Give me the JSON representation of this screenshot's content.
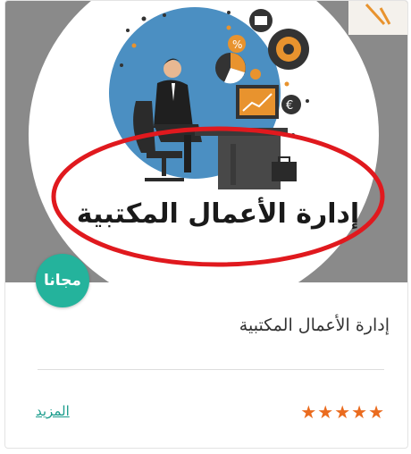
{
  "course": {
    "cover_text": "إدارة الأعمال المكتبية",
    "badge": "مجانا",
    "title": "إدارة الأعمال المكتبية",
    "rating": 5,
    "more_label": "المزيد"
  },
  "colors": {
    "accent_teal": "#24b39c",
    "star_orange": "#ea6b1e",
    "annotation_red": "#e0191e",
    "circle_blue": "#4b8fc2"
  }
}
